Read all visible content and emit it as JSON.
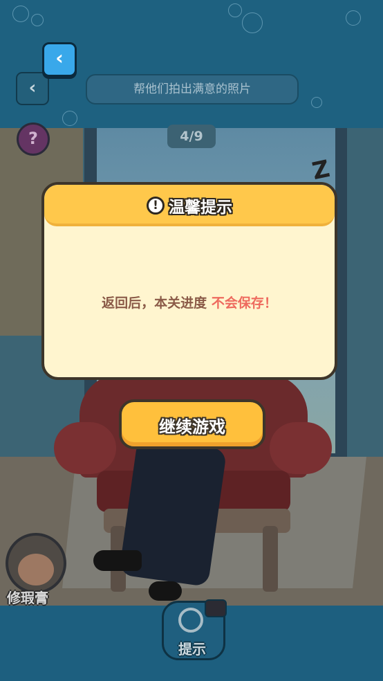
{
  "header": {
    "task_text": "帮他们拍出满意的照片",
    "progress": "4/9",
    "help_symbol": "?",
    "back_symbol": "‹"
  },
  "scene": {
    "tool_label": "修瑕膏",
    "hint_label": "提示",
    "sleep_symbol": "Z"
  },
  "dialog": {
    "title": "温馨提示",
    "alert_symbol": "!",
    "message_main": "返回后，本关进度",
    "message_warning": "不会保存！",
    "continue_label": "继续游戏"
  },
  "colors": {
    "dialog_bg": "#fff5cf",
    "dialog_header": "#ffc84b",
    "button": "#ffc03c",
    "warning_text": "#ee6a5e",
    "message_text": "#8a5a47",
    "back_button": "#39a8ea"
  }
}
